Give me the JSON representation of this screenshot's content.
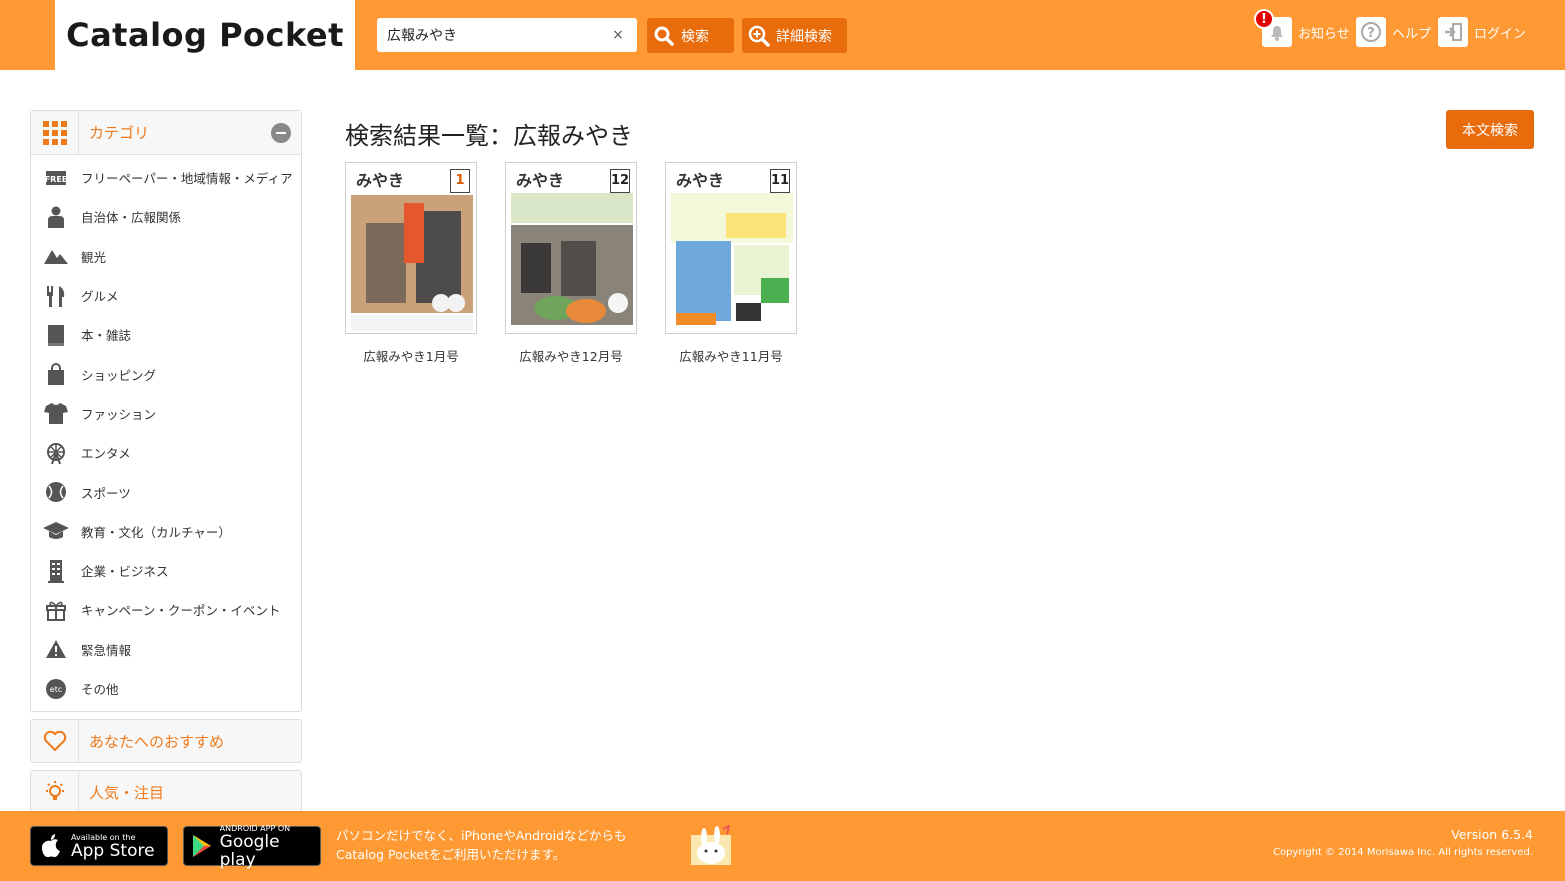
{
  "header": {
    "logo": "Catalog Pocket",
    "search": {
      "value": "広報みやき",
      "clear": "×"
    },
    "search_button": "検索",
    "advanced_button": "詳細検索",
    "links": [
      {
        "label": "お知らせ",
        "icon": "bell-icon",
        "badge": "!"
      },
      {
        "label": "ヘルプ",
        "icon": "help-icon"
      },
      {
        "label": "ログイン",
        "icon": "login-icon"
      }
    ]
  },
  "sidebar": {
    "category_head": "カテゴリ",
    "categories": [
      {
        "label": "フリーペーパー・地域情報・メディア",
        "icon": "free-icon"
      },
      {
        "label": "自治体・広報関係",
        "icon": "official-person-icon"
      },
      {
        "label": "観光",
        "icon": "mountain-icon"
      },
      {
        "label": "グルメ",
        "icon": "fork-knife-icon"
      },
      {
        "label": "本・雑誌",
        "icon": "book-icon"
      },
      {
        "label": "ショッピング",
        "icon": "shopping-bag-icon"
      },
      {
        "label": "ファッション",
        "icon": "tshirt-icon"
      },
      {
        "label": "エンタメ",
        "icon": "ferris-wheel-icon"
      },
      {
        "label": "スポーツ",
        "icon": "baseball-icon"
      },
      {
        "label": "教育・文化（カルチャー）",
        "icon": "graduation-cap-icon"
      },
      {
        "label": "企業・ビジネス",
        "icon": "building-icon"
      },
      {
        "label": "キャンペーン・クーポン・イベント",
        "icon": "gift-icon"
      },
      {
        "label": "緊急情報",
        "icon": "warning-icon"
      },
      {
        "label": "その他",
        "icon": "etc-icon",
        "icon_text": "etc"
      }
    ],
    "recommend": "あなたへのおすすめ",
    "popular": "人気・注目"
  },
  "main": {
    "title": "検索結果一覧：広報みやき",
    "fulltext_button": "本文検索",
    "results": [
      {
        "title": "広報みやき1月号",
        "cover_title": "みやき",
        "issue": "1"
      },
      {
        "title": "広報みやき12月号",
        "cover_title": "みやき",
        "issue": "12"
      },
      {
        "title": "広報みやき11月号",
        "cover_title": "みやき",
        "issue": "11"
      }
    ]
  },
  "footer": {
    "appstore_small": "Available on the",
    "appstore_big": "App Store",
    "gplay_small": "ANDROID APP ON",
    "gplay_big": "Google play",
    "text_line1": "パソコンだけでなく、iPhoneやAndroidなどからも",
    "text_line2": "Catalog Pocketをご利用いただけます。",
    "version": "Version 6.5.4",
    "copyright": "Copyright © 2014 Morisawa Inc. All rights reserved."
  },
  "colors": {
    "brand_orange": "#ff9933",
    "button_orange": "#e96c0c",
    "accent_text": "#ee7a1c"
  }
}
